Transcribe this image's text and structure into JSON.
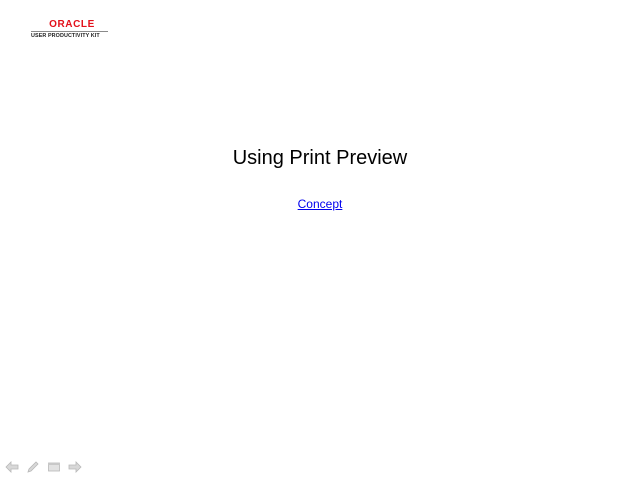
{
  "logo": {
    "brand": "ORACLE",
    "subtitle": "USER PRODUCTIVITY KIT"
  },
  "main": {
    "title": "Using Print Preview",
    "concept_link": "Concept"
  },
  "toolbar": {
    "buttons": [
      {
        "icon": "back-arrow-icon"
      },
      {
        "icon": "pencil-icon"
      },
      {
        "icon": "window-icon"
      },
      {
        "icon": "forward-arrow-icon"
      }
    ]
  },
  "colors": {
    "brand_red": "#e3101a",
    "link_blue": "#0000ee",
    "toolbar_icon_gray": "#c8c8c8"
  }
}
